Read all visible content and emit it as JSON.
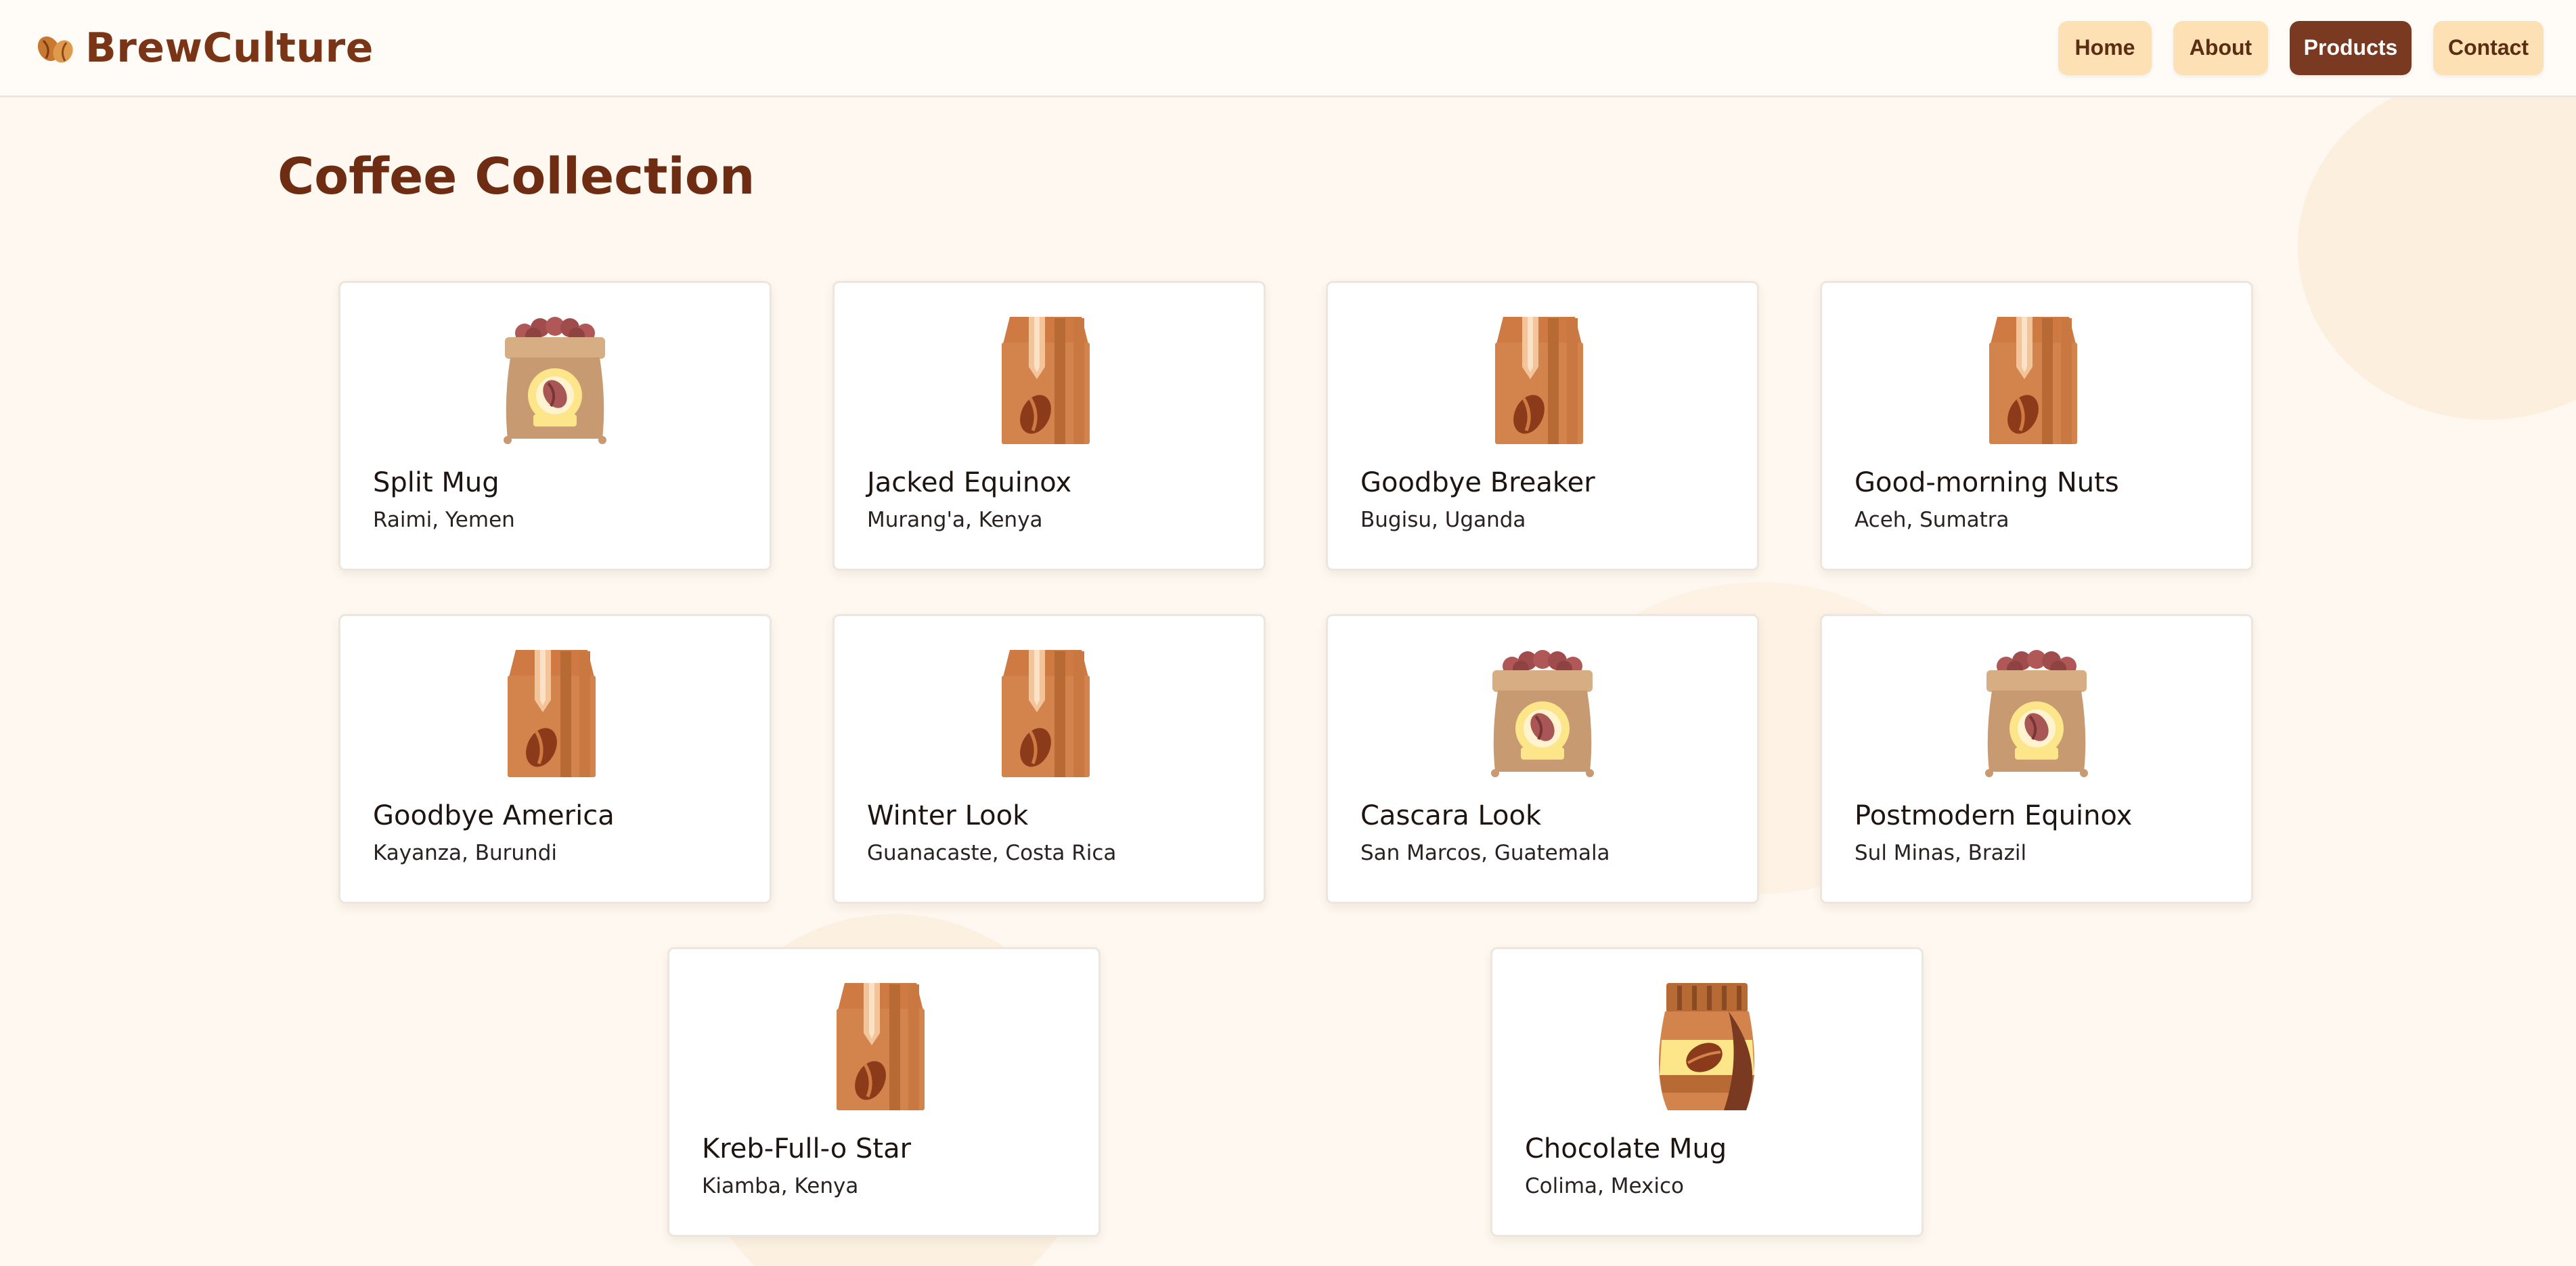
{
  "header": {
    "brand": "BrewCulture",
    "logo_icon": "coffee-beans-icon",
    "nav": [
      {
        "label": "Home",
        "active": false
      },
      {
        "label": "About",
        "active": false
      },
      {
        "label": "Products",
        "active": true
      },
      {
        "label": "Contact",
        "active": false
      }
    ]
  },
  "main": {
    "title": "Coffee Collection",
    "products": [
      {
        "name": "Split Mug",
        "origin": "Raimi, Yemen",
        "icon": "coffee-sack-icon"
      },
      {
        "name": "Jacked Equinox",
        "origin": "Murang'a, Kenya",
        "icon": "coffee-bag-icon"
      },
      {
        "name": "Goodbye Breaker",
        "origin": "Bugisu, Uganda",
        "icon": "coffee-bag-icon"
      },
      {
        "name": "Good-morning Nuts",
        "origin": "Aceh, Sumatra",
        "icon": "coffee-bag-icon"
      },
      {
        "name": "Goodbye America",
        "origin": "Kayanza, Burundi",
        "icon": "coffee-bag-icon"
      },
      {
        "name": "Winter Look",
        "origin": "Guanacaste, Costa Rica",
        "icon": "coffee-bag-icon"
      },
      {
        "name": "Cascara Look",
        "origin": "San Marcos, Guatemala",
        "icon": "coffee-sack-icon"
      },
      {
        "name": "Postmodern Equinox",
        "origin": "Sul Minas, Brazil",
        "icon": "coffee-sack-icon"
      },
      {
        "name": "Kreb-Full-o Star",
        "origin": "Kiamba, Kenya",
        "icon": "coffee-bag-icon"
      },
      {
        "name": "Chocolate Mug",
        "origin": "Colima, Mexico",
        "icon": "coffee-pouch-icon"
      }
    ]
  },
  "colors": {
    "brand": "#7a3517",
    "nav_button": "#fde0b3",
    "nav_active": "#7a3a22",
    "page_background": "#fef8f0"
  }
}
